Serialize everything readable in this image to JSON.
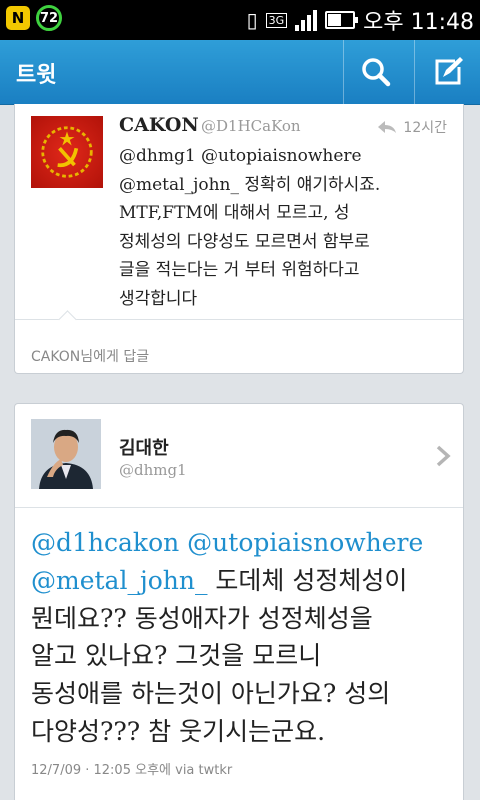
{
  "status_bar": {
    "notification_badge": "N",
    "battery_percent": "72",
    "network": "3G",
    "battery_level": 0.55,
    "time": "오후 11:48"
  },
  "header": {
    "title": "트윗",
    "search_icon": "search-icon",
    "compose_icon": "compose-icon",
    "color": "#1a7fc2"
  },
  "tweet1": {
    "name": "CAKON",
    "handle": "@D1HCaKon",
    "time": "12시간",
    "lines": [
      "@dhmg1 @utopiaisnowhere",
      "@metal_john_ 정확히 얘기하시죠.",
      "MTF,FTM에 대해서 모르고, 성",
      "정체성의 다양성도 모르면서 함부로",
      "글을 적는다는 거 부터 위험하다고",
      "생각합니다"
    ],
    "reply_to": "CAKON님에게 답글"
  },
  "tweet2": {
    "name": "김대한",
    "handle": "@dhmg1",
    "mentions": [
      "@d1hcakon",
      "@utopiaisnowhere",
      "@metal_john_"
    ],
    "text_line2": "도데체 성정체성이",
    "text_line3": "뭔데요?? 동성애자가 성정체성을",
    "text_line4": "알고 있나요? 그것을 모르니",
    "text_line5": "동성애를 하는것이 아닌가요? 성의",
    "text_line6": "다양성??? 참 웃기시는군요.",
    "meta": "12/7/09 · 12:05 오후에 via twtkr",
    "mention_color": "#1f8fce"
  }
}
